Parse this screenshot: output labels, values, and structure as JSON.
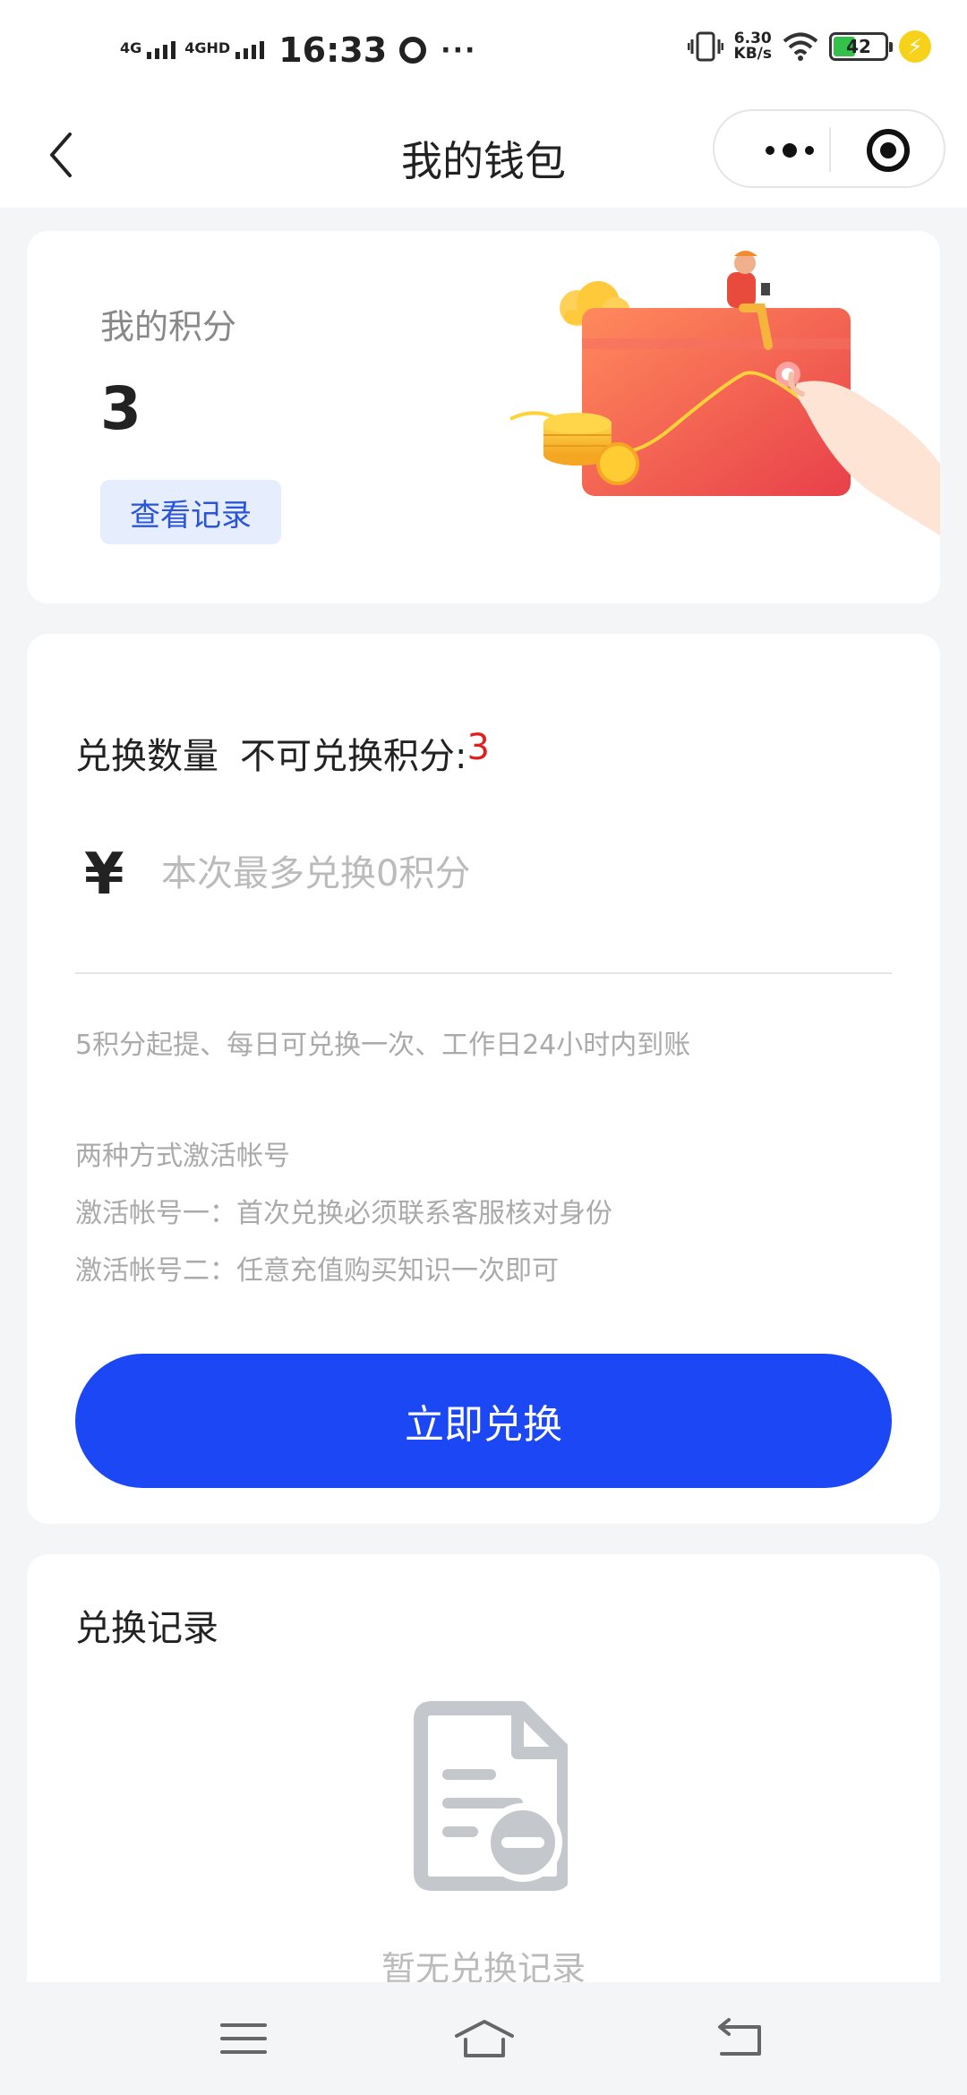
{
  "status_bar": {
    "network1": "4G",
    "network2": "4GHD",
    "time": "16:33",
    "more": "···",
    "speed_value": "6.30",
    "speed_unit": "KB/s",
    "battery": "42",
    "icons": [
      "signal-icon",
      "q-icon",
      "vibrate-icon",
      "wifi-icon",
      "battery-icon",
      "charging-icon"
    ]
  },
  "nav": {
    "title": "我的钱包",
    "icons": [
      "back-arrow-icon",
      "more-dots-icon",
      "target-icon"
    ]
  },
  "points_card": {
    "label": "我的积分",
    "value": "3",
    "record_button": "查看记录"
  },
  "exchange_card": {
    "quantity_label": "兑换数量",
    "not_exchangeable_label": "不可兑换积分:",
    "not_exchangeable_value": "3",
    "currency_symbol": "¥",
    "input_placeholder": "本次最多兑换0积分",
    "note_rule": "5积分起提、每日可兑换一次、工作日24小时内到账",
    "note_activate_title": "两种方式激活帐号",
    "note_activate_1": "激活帐号一：首次兑换必须联系客服核对身份",
    "note_activate_2": "激活帐号二：任意充值购买知识一次即可",
    "button": "立即兑换"
  },
  "records_card": {
    "title": "兑换记录",
    "empty_text": "暂无兑换记录",
    "icon": "empty-document-icon"
  },
  "system_nav": {
    "icons": [
      "menu-icon",
      "home-icon",
      "back-icon"
    ]
  },
  "colors": {
    "primary": "#1b47f5",
    "accent_red": "#e02020",
    "record_btn_bg": "#e6eefe",
    "record_btn_text": "#2a55d8",
    "page_bg": "#f4f5f7"
  }
}
